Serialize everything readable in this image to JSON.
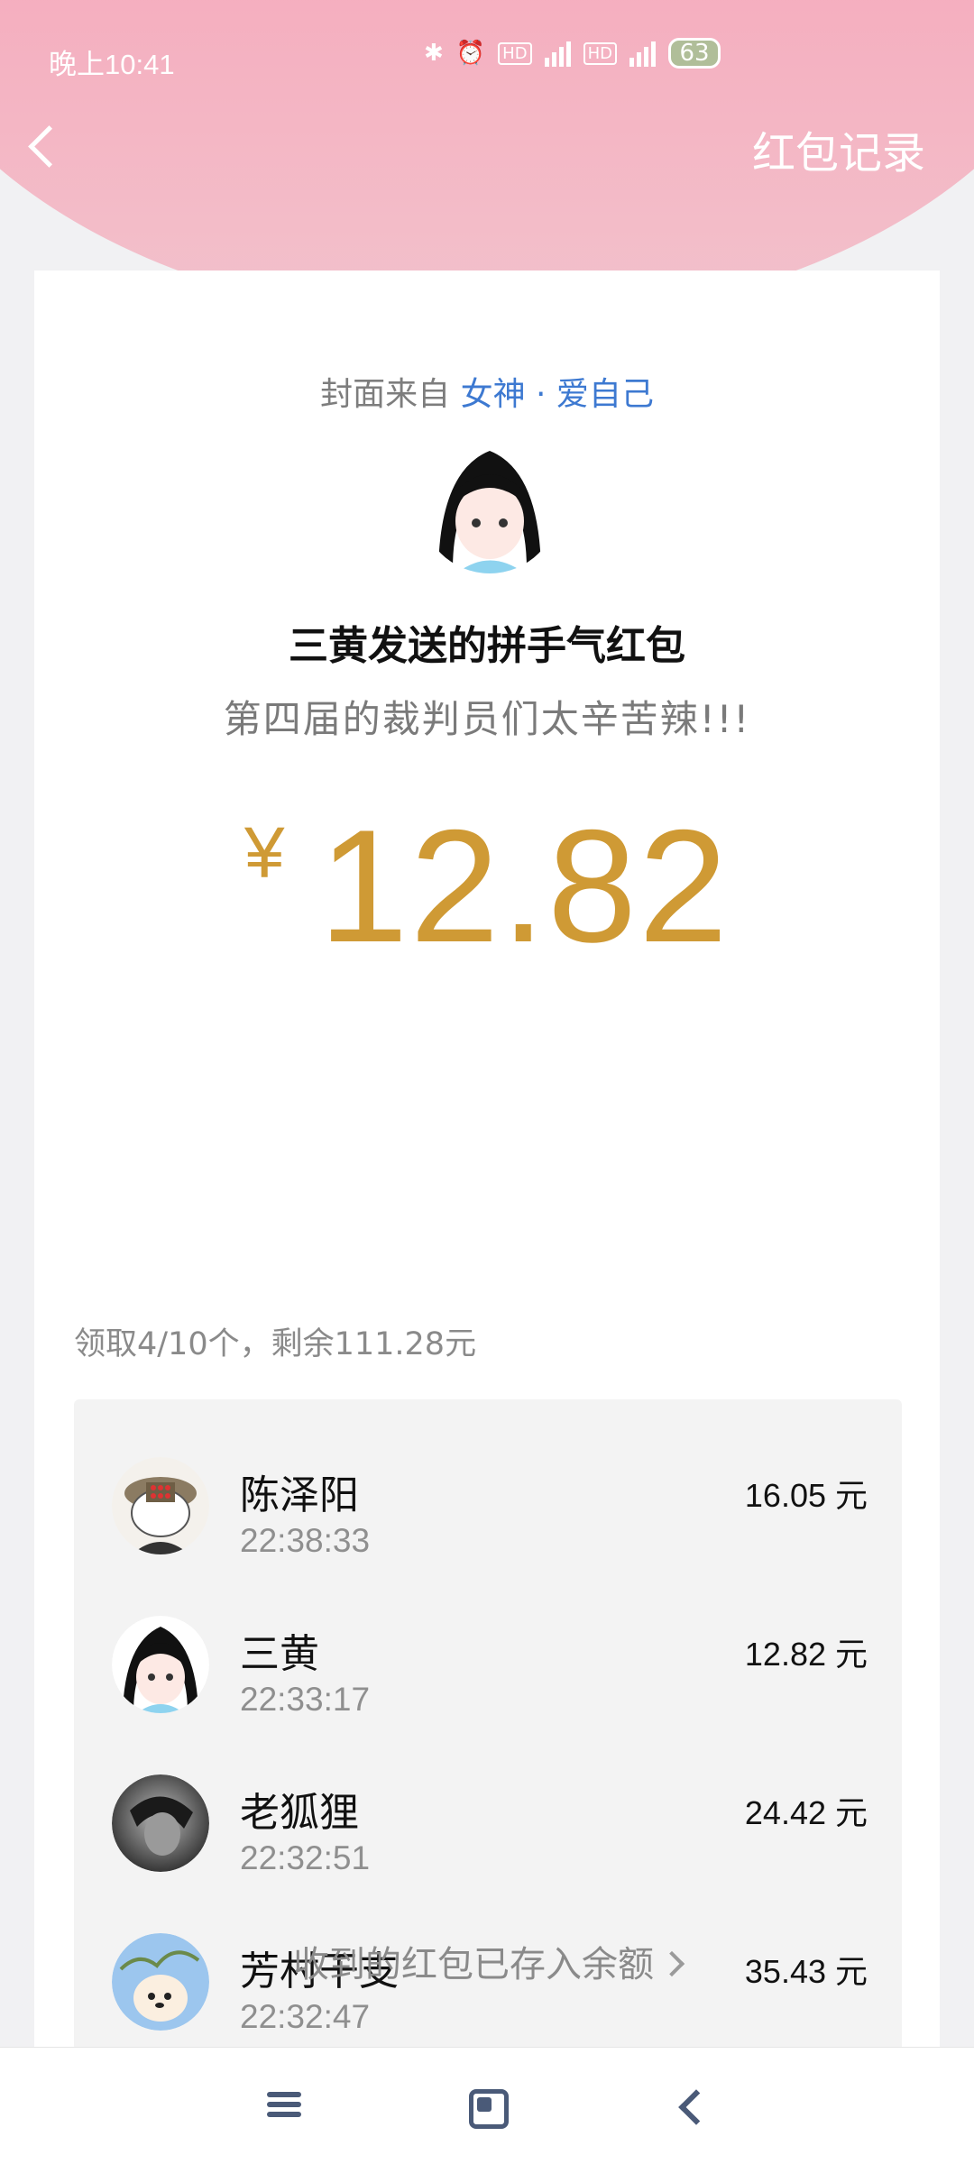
{
  "status_bar": {
    "time": "晚上10:41",
    "icons": [
      "bluetooth-icon",
      "alarm-icon",
      "hd-icon",
      "signal-4g-icon",
      "hd-icon",
      "signal-4g-icon"
    ],
    "battery": "63"
  },
  "header": {
    "back_icon": "chevron-left-icon",
    "records_label": "红包记录"
  },
  "cover": {
    "prefix": "封面来自",
    "source": "女神 · 爱自己"
  },
  "packet": {
    "title": "三黄发送的拼手气红包",
    "greeting": "第四届的裁判员们太辛苦辣!!!",
    "currency": "¥",
    "amount": "12.82"
  },
  "claims": {
    "summary": "领取4/10个，剩余111.28元",
    "items": [
      {
        "name": "陈泽阳",
        "time": "22:38:33",
        "amount": "16.05 元"
      },
      {
        "name": "三黄",
        "time": "22:33:17",
        "amount": "12.82 元"
      },
      {
        "name": "老狐狸",
        "time": "22:32:51",
        "amount": "24.42 元"
      },
      {
        "name": "芳村干支",
        "time": "22:32:47",
        "amount": "35.43 元"
      }
    ]
  },
  "footer": {
    "saved_note": "收到的红包已存入余额"
  },
  "colors": {
    "amount": "#cf9a35",
    "link": "#3d79d1",
    "header_pink": "#f6a8bb"
  }
}
